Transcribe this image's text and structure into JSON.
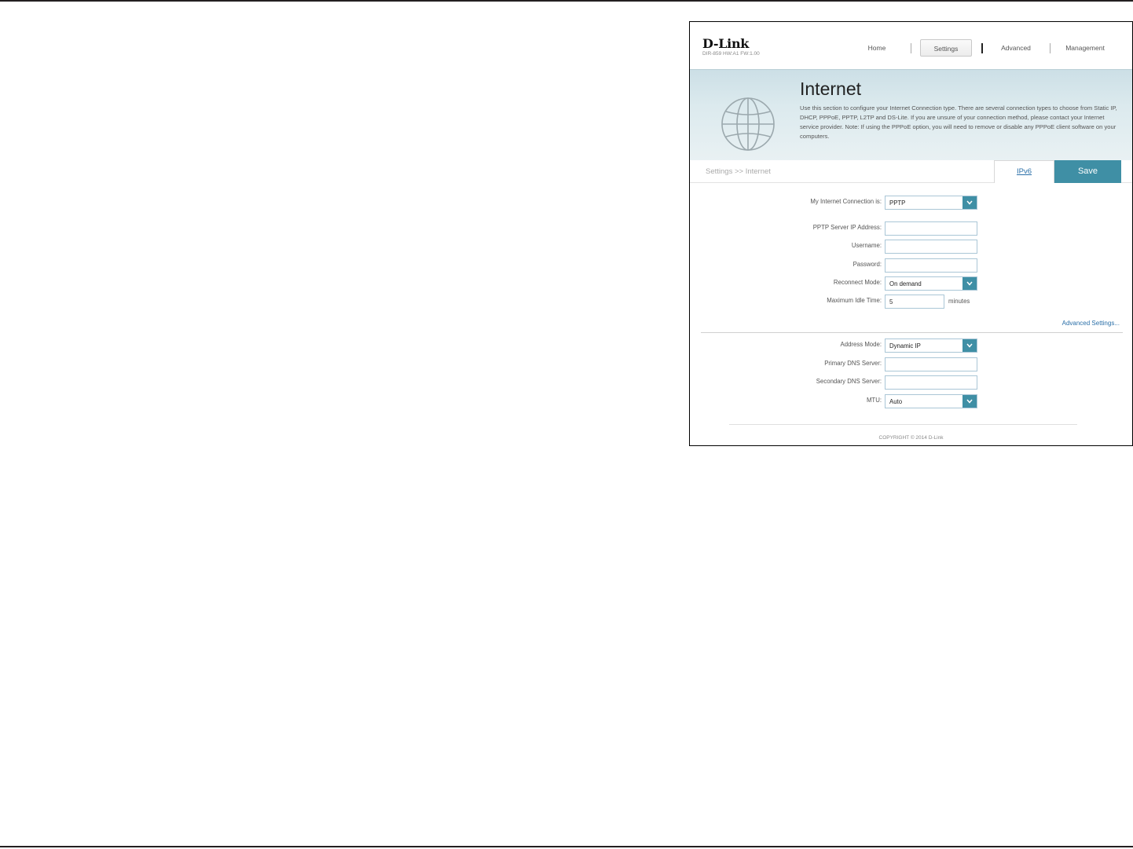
{
  "brand": {
    "logo": "D-Link",
    "model_info": "DIR-859   HW:A1   FW:1.00"
  },
  "nav": {
    "home": "Home",
    "settings": "Settings",
    "advanced": "Advanced",
    "management": "Management",
    "active": "Settings"
  },
  "banner": {
    "title": "Internet",
    "description": "Use this section to configure your Internet Connection type. There are several connection types to choose from Static IP, DHCP, PPPoE, PPTP, L2TP and DS-Lite. If you are unsure of your connection method, please contact your Internet service provider. Note: If using the PPPoE option, you will need to remove or disable any PPPoE client software on your computers."
  },
  "breadcrumb": "Settings >> Internet",
  "buttons": {
    "ipv6": "IPv6",
    "save": "Save"
  },
  "form": {
    "connection": {
      "label": "My Internet Connection is:",
      "value": "PPTP"
    },
    "server_ip": {
      "label": "PPTP Server IP Address:",
      "value": ""
    },
    "username": {
      "label": "Username:",
      "value": ""
    },
    "password": {
      "label": "Password:",
      "value": ""
    },
    "reconnect": {
      "label": "Reconnect Mode:",
      "value": "On demand"
    },
    "idle_time": {
      "label": "Maximum Idle Time:",
      "value": "5",
      "unit": "minutes"
    },
    "advanced_link": "Advanced Settings...",
    "address_mode": {
      "label": "Address Mode:",
      "value": "Dynamic IP"
    },
    "primary_dns": {
      "label": "Primary DNS Server:",
      "value": ""
    },
    "secondary_dns": {
      "label": "Secondary DNS Server:",
      "value": ""
    },
    "mtu": {
      "label": "MTU:",
      "value": "Auto"
    }
  },
  "footer": {
    "copyright": "COPYRIGHT © 2014 D-Link"
  },
  "colors": {
    "accent": "#3f8fa5",
    "link": "#2a6fa8",
    "banner": "#dceaee",
    "field_border": "#aac6d6"
  }
}
